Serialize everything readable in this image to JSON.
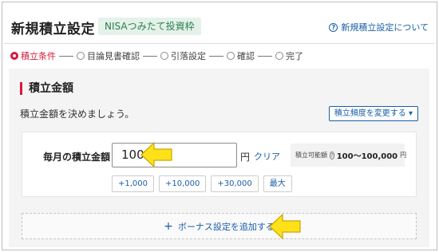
{
  "header": {
    "title": "新規積立設定",
    "badge": "NISAつみたて投資枠",
    "help_link": "新規積立設定について",
    "help_icon": "question-circle-icon"
  },
  "steps": [
    {
      "label": "積立条件",
      "active": true
    },
    {
      "label": "目論見書確認",
      "active": false
    },
    {
      "label": "引落設定",
      "active": false
    },
    {
      "label": "確認",
      "active": false
    },
    {
      "label": "完了",
      "active": false
    }
  ],
  "section": {
    "title": "積立金額",
    "description": "積立金額を決めましょう。",
    "frequency_button": "積立頻度を変更する ▾"
  },
  "amount": {
    "label": "毎月の積立金額",
    "value": "100",
    "unit": "円",
    "clear": "クリア",
    "range_caption": "積立可能額",
    "range_value": "100〜100,000",
    "range_unit": "円"
  },
  "quick_buttons": [
    "+1,000",
    "+10,000",
    "+30,000",
    "最大"
  ],
  "bonus": {
    "plus": "+",
    "label": "ボーナス設定を追加する"
  },
  "colors": {
    "accent_red": "#d7193a",
    "link_blue": "#1a5ea8",
    "badge_green_bg": "#e4f2ea",
    "annotation_yellow": "#ffe11a"
  },
  "annotations": [
    "arrow-pointing-left",
    "arrow-pointing-left"
  ]
}
